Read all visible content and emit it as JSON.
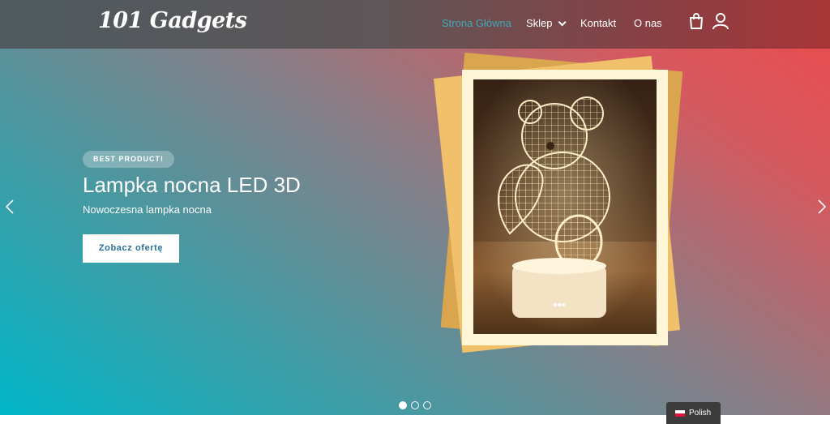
{
  "brand": {
    "logo_text": "101 Gadgets"
  },
  "nav": {
    "items": [
      {
        "label": "Strona Główna",
        "active": true
      },
      {
        "label": "Sklep",
        "has_dropdown": true
      },
      {
        "label": "Kontakt"
      },
      {
        "label": "O nas"
      }
    ],
    "cart_icon": "shopping-bag-icon",
    "account_icon": "user-icon"
  },
  "hero": {
    "badge": "BEST PRODUCT!",
    "title": "Lampka nocna LED 3D",
    "subtitle": "Nowoczesna lampka nocna",
    "cta_label": "Zobacz ofertę",
    "prev_icon": "chevron-left-icon",
    "next_icon": "chevron-right-icon",
    "slides_total": 3,
    "slide_active": 1
  },
  "language": {
    "label": "Polish",
    "flag_icon": "poland-flag-icon"
  },
  "colors": {
    "active_link": "#3fa9b7",
    "cta_text": "#2a6f96",
    "gradient_start": "#00b6c8",
    "gradient_end": "#ee4a4c"
  }
}
